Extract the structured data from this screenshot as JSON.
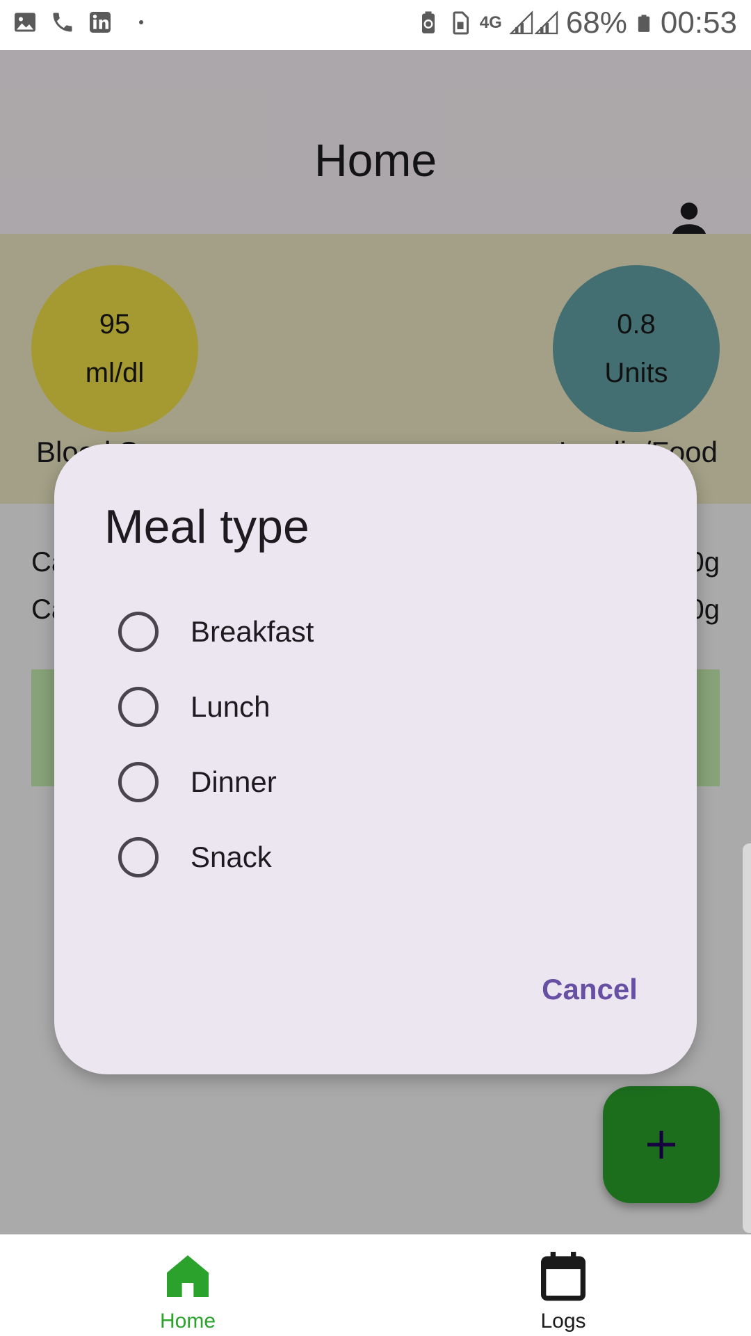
{
  "status_bar": {
    "network": "4G",
    "battery_percent": "68%",
    "time": "00:53",
    "icons": [
      "image-icon",
      "phone-icon",
      "linkedin-icon",
      "battery-saver-icon",
      "sim-icon",
      "signal-icon",
      "battery-icon"
    ]
  },
  "app_bar": {
    "title": "Home",
    "account_icon": "account-icon"
  },
  "stats": {
    "blood_sugar": {
      "value": "95",
      "unit": "ml/dl",
      "label": "Blood S",
      "color": "#f3e24a"
    },
    "insulin": {
      "value": "0.8",
      "unit": "Units",
      "label": "Insulin/Food",
      "color": "#63a4a8"
    }
  },
  "carbs": {
    "row1_label": "Ca",
    "row1_value": "0g",
    "row2_label": "Ca",
    "row2_value": "0g",
    "card_color": "#c7efb1"
  },
  "fab": {
    "icon": "plus-icon",
    "color": "#2aa22c"
  },
  "dialog": {
    "title": "Meal type",
    "options": [
      {
        "label": "Breakfast",
        "selected": false
      },
      {
        "label": "Lunch",
        "selected": false
      },
      {
        "label": "Dinner",
        "selected": false
      },
      {
        "label": "Snack",
        "selected": false
      }
    ],
    "cancel_label": "Cancel",
    "accent_color": "#6750a4"
  },
  "bottom_nav": {
    "items": [
      {
        "label": "Home",
        "icon": "home-icon",
        "active": true
      },
      {
        "label": "Logs",
        "icon": "calendar-icon",
        "active": false
      }
    ],
    "active_color": "#2aa22c"
  }
}
